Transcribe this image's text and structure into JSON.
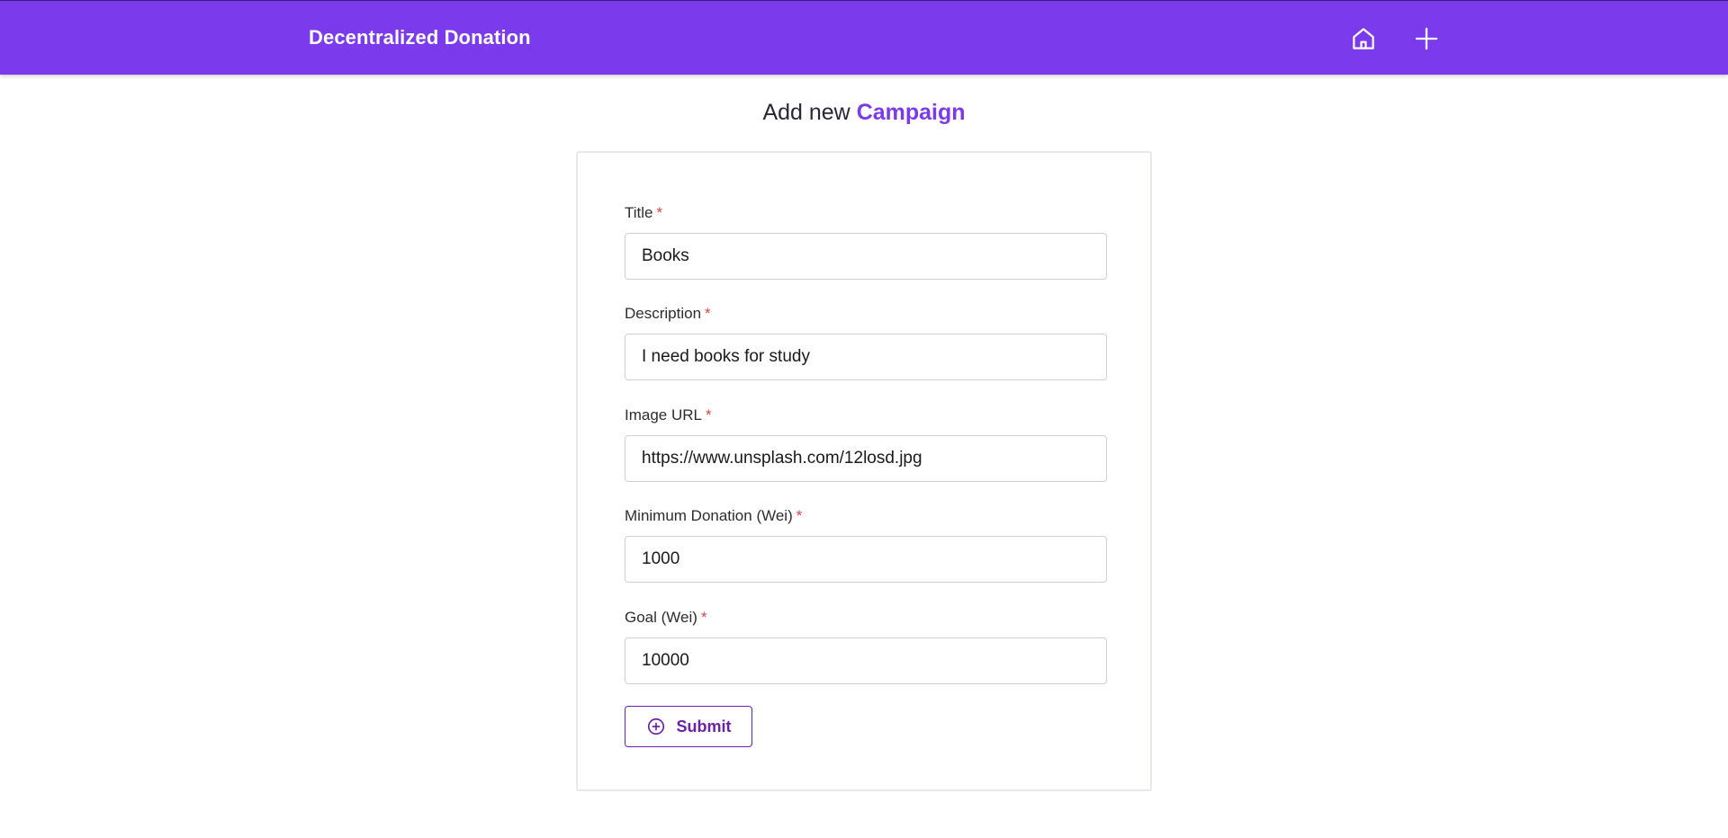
{
  "navbar": {
    "brand": "Decentralized Donation",
    "icons": [
      "home-icon",
      "plus-icon"
    ],
    "background_color": "#7c3aed"
  },
  "heading": {
    "prefix": "Add new",
    "accent": "Campaign",
    "accent_color": "#7c3aed"
  },
  "form": {
    "required_marker": "*",
    "fields": [
      {
        "label": "Title",
        "value": "Books"
      },
      {
        "label": "Description",
        "value": "I need books for study"
      },
      {
        "label": "Image URL",
        "value": "https://www.unsplash.com/12losd.jpg"
      },
      {
        "label": "Minimum Donation (Wei)",
        "value": "1000"
      },
      {
        "label": "Goal (Wei)",
        "value": "10000"
      }
    ],
    "submit_label": "Submit",
    "submit_icon": "plus-circle-icon",
    "submit_color": "#6b21a8"
  }
}
